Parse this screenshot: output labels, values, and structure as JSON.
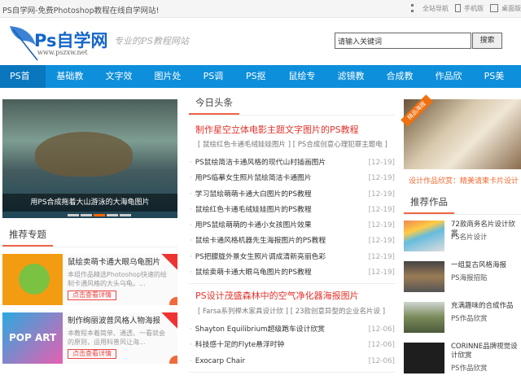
{
  "topbar": {
    "title": "PS自学网-免费Photoshop教程在线自学网站!",
    "links": [
      "全站导航",
      "手机版",
      "桌面版"
    ]
  },
  "header": {
    "logo_text": "Ps自学网",
    "logo_url": "www.pszxw.net",
    "slogan": "专业的PS教程网站",
    "search_placeholder": "请输入关键词",
    "search_button": "搜索"
  },
  "nav": [
    "PS首页",
    "基础教程",
    "文字效果",
    "图片处理",
    "PS调色",
    "PS抠图",
    "鼠绘专区",
    "滤镜教程",
    "合成教程",
    "作品欣赏",
    "PS美化"
  ],
  "banner": {
    "caption": "用PS合成拖着大山游泳的大海龟图片"
  },
  "topics": {
    "title": "推荐专题",
    "items": [
      {
        "title": "鼠绘卖萌卡通大眼乌龟图片",
        "desc": "本组作品精选Photoshop快速的绘制卡通风格的大头乌龟。...",
        "button": "点击查看详情"
      },
      {
        "title": "制作绚丽波普风格人物海报",
        "desc": "本教程本着简单、通透、一看就会的原则，运用科普风让海...",
        "button": "点击查看详情"
      }
    ]
  },
  "today": {
    "title": "今日头条",
    "headline1": "制作星空立体电影主题文字图片的PS教程",
    "sub1": "[ 鼠绘红色卡通毛绒娃娃图片 ] [ PS合成创意心理犯罪主题电 ]",
    "list1": [
      {
        "t": "PS鼠绘简洁卡通风格的现代山村插画图片",
        "d": "[12-19]"
      },
      {
        "t": "用PS临摹女生照片鼠绘简洁卡通图片",
        "d": "[12-19]"
      },
      {
        "t": "学习鼠绘萌萌卡通大白图片的PS教程",
        "d": "[12-19]"
      },
      {
        "t": "鼠绘红色卡通毛绒娃娃图片的PS教程",
        "d": "[12-19]"
      },
      {
        "t": "用PS鼠绘萌萌的卡通小女孩图片效果",
        "d": "[12-19]"
      },
      {
        "t": "鼠绘卡通风格机器先生海报图片的PS教程",
        "d": "[12-19]"
      },
      {
        "t": "PS把朦胧外景女生照片调成清新亮丽色彩",
        "d": "[12-19]"
      },
      {
        "t": "鼠绘卖萌卡通大眼乌龟图片的PS教程",
        "d": "[12-19]"
      }
    ],
    "headline2": "PS设计茂盛森林中的空气净化器海报图片",
    "sub2": "[ Farsa系列榉木家具设计欣 ] [ 23款创意异型的企业名片设 ]",
    "list2": [
      {
        "t": "Shayton Equilibrium超级跑车设计欣赏",
        "d": "[12-06]"
      },
      {
        "t": "科技感十足的Flyte悬浮时钟",
        "d": "[12-06]"
      },
      {
        "t": "Exocarp Chair",
        "d": "[12-06]"
      }
    ]
  },
  "featured": {
    "tag": "精品海报",
    "caption": "设计作品欣赏：精美请柬卡片设计"
  },
  "works": {
    "title": "推荐作品",
    "items": [
      {
        "title": "72款商务名片设计欣赏",
        "cat": "PS名片设计"
      },
      {
        "title": "一组复古风格海报",
        "cat": "PS海报招贴"
      },
      {
        "title": "充满趣味的合成作品",
        "cat": "PS作品欣赏"
      },
      {
        "title": "CORINNE品牌视觉设计欣赏",
        "cat": "PS作品欣赏"
      }
    ]
  }
}
